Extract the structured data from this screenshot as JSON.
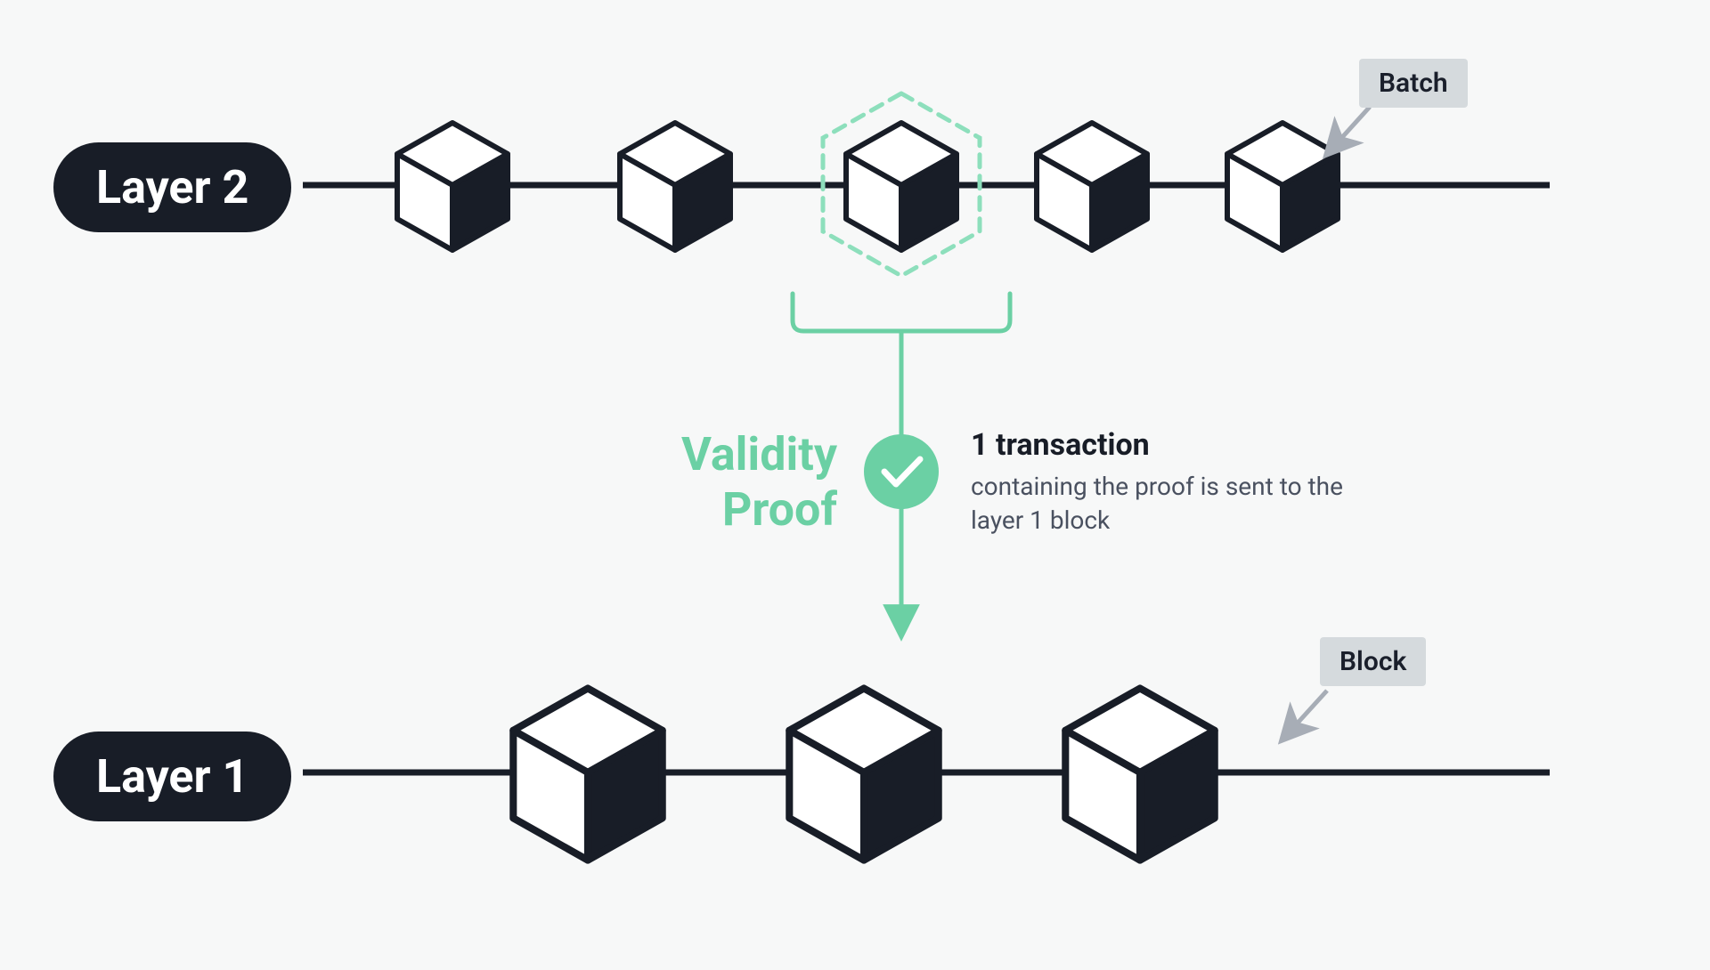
{
  "labels": {
    "layer2": "Layer 2",
    "layer1": "Layer 1",
    "batch": "Batch",
    "block": "Block",
    "validity_line1": "Validity",
    "validity_line2": "Proof",
    "transaction_title": "1 transaction",
    "transaction_body": "containing the proof is sent to the layer 1 block"
  },
  "colors": {
    "dark": "#181d27",
    "accent": "#6bd0a4",
    "bg": "#f7f8f8",
    "tagbg": "#d5dadd",
    "arrow": "#a7adb6"
  }
}
